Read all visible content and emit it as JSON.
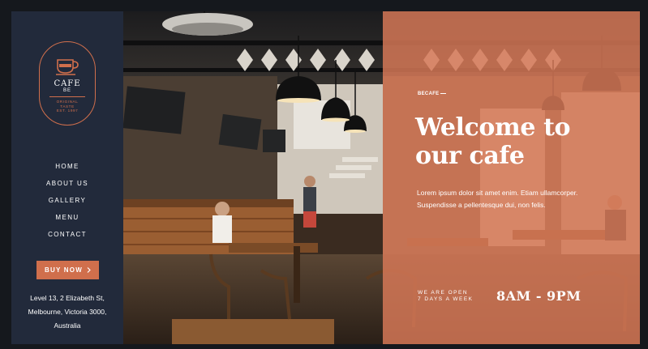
{
  "colors": {
    "sidebar_bg": "#222a3b",
    "accent": "#d06f4c",
    "overlay": "#d67857",
    "text": "#ffffff"
  },
  "logo": {
    "icon": "coffee-cup-icon",
    "name": "CAFE",
    "sub": "BE",
    "tagline_1": "ORIGINAL",
    "tagline_2": "TASTE",
    "tagline_3": "EST. 1997"
  },
  "nav": {
    "items": [
      {
        "label": "HOME"
      },
      {
        "label": "ABOUT US"
      },
      {
        "label": "GALLERY"
      },
      {
        "label": "MENU"
      },
      {
        "label": "CONTACT"
      }
    ]
  },
  "cta": {
    "label": "BUY NOW",
    "icon": "chevron-right-icon"
  },
  "address": {
    "line1": "Level 13, 2 Elizabeth St,",
    "line2": "Melbourne, Victoria 3000,",
    "line3": "Australia"
  },
  "hero": {
    "kicker": "BECAFE",
    "headline_1": "Welcome to",
    "headline_2": "our cafe",
    "body": "Lorem ipsum dolor sit amet enim. Etiam ullamcorper. Suspendisse a pellentesque dui, non felis.",
    "open_1": "WE ARE OPEN",
    "open_2": "7 DAYS A WEEK",
    "hours": "8AM - 9PM"
  }
}
